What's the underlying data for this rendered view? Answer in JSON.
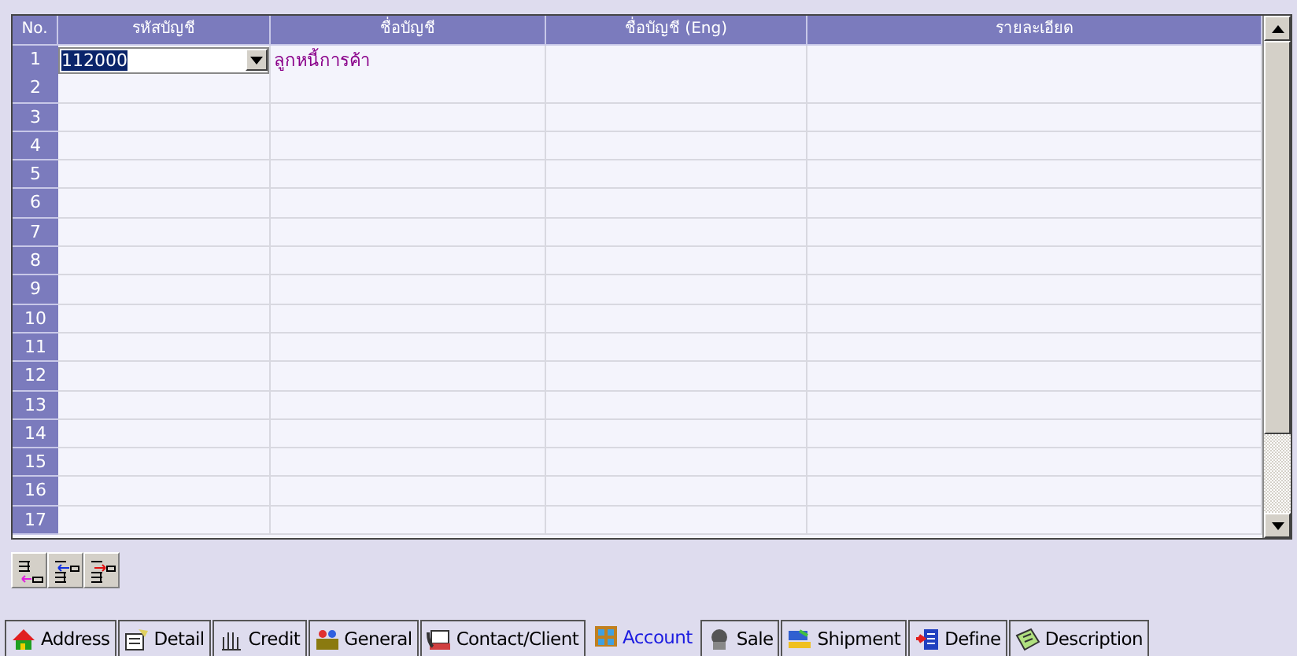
{
  "table": {
    "columns": [
      "No.",
      "รหัสบัญชี",
      "ชื่อบัญชี",
      "ชื่อบัญชี (Eng)",
      "รายละเอียด"
    ],
    "rows": [
      {
        "no": "1",
        "account_code": "112000",
        "account_name": "ลูกหนี้การค้า"
      },
      {
        "no": "2"
      },
      {
        "no": "3"
      },
      {
        "no": "4"
      },
      {
        "no": "5"
      },
      {
        "no": "6"
      },
      {
        "no": "7"
      },
      {
        "no": "8"
      },
      {
        "no": "9"
      },
      {
        "no": "10"
      },
      {
        "no": "11"
      },
      {
        "no": "12"
      },
      {
        "no": "13"
      },
      {
        "no": "14"
      },
      {
        "no": "15"
      },
      {
        "no": "16"
      },
      {
        "no": "17"
      }
    ]
  },
  "tabs": [
    {
      "label": "Address",
      "selected": false
    },
    {
      "label": "Detail",
      "selected": false
    },
    {
      "label": "Credit",
      "selected": false
    },
    {
      "label": "General",
      "selected": false
    },
    {
      "label": "Contact/Client",
      "selected": false
    },
    {
      "label": "Account",
      "selected": true
    },
    {
      "label": "Sale",
      "selected": false
    },
    {
      "label": "Shipment",
      "selected": false
    },
    {
      "label": "Define",
      "selected": false
    },
    {
      "label": "Description",
      "selected": false
    }
  ]
}
